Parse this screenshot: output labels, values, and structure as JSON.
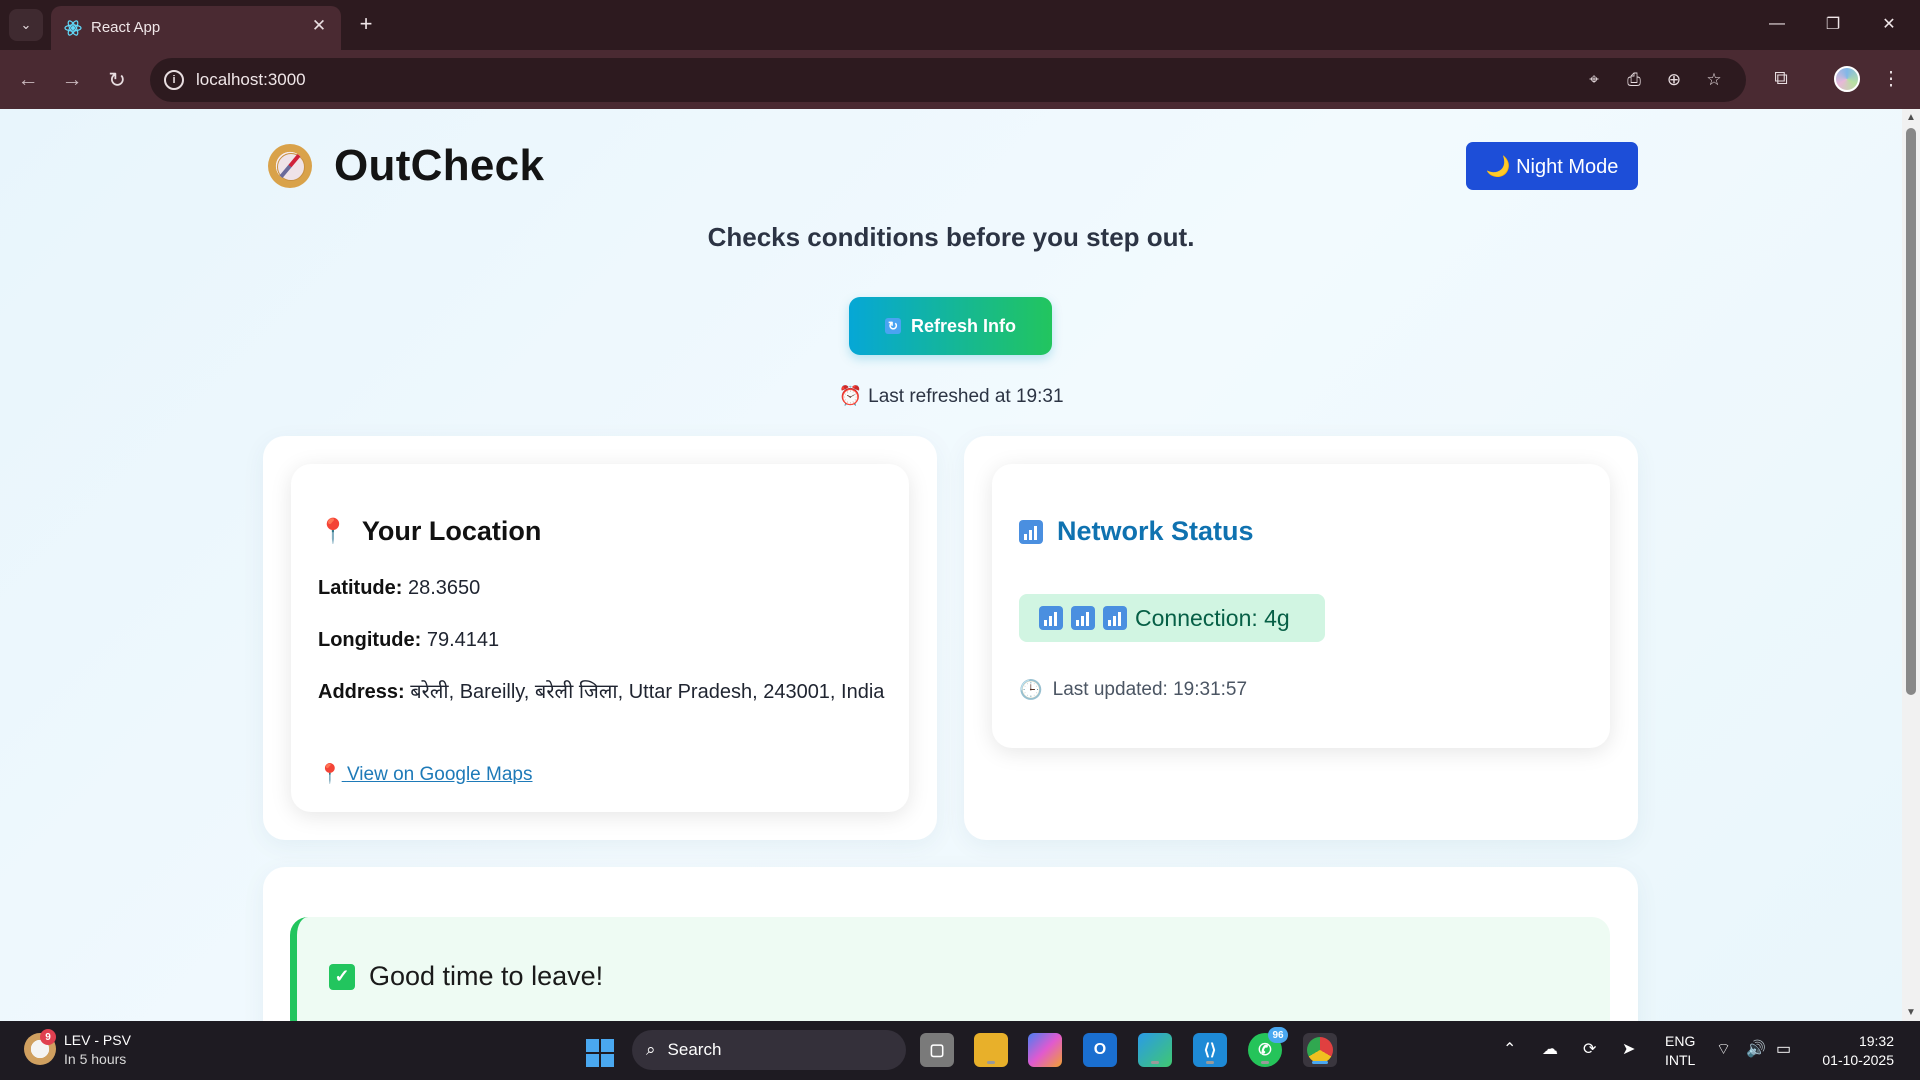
{
  "browser": {
    "tab_title": "React App",
    "url": "localhost:3000"
  },
  "app": {
    "brand_title": "OutCheck",
    "night_mode_label": "🌙 Night Mode",
    "tagline": "Checks conditions before you step out.",
    "refresh_label": "Refresh Info",
    "last_refreshed": "Last refreshed at 19:31"
  },
  "location": {
    "title": "Your Location",
    "latitude_label": "Latitude:",
    "latitude_value": "28.3650",
    "longitude_label": "Longitude:",
    "longitude_value": "79.4141",
    "address_label": "Address:",
    "address_value": "बरेली, Bareilly, बरेली जिला, Uttar Pradesh, 243001, India",
    "maps_link": "View on Google Maps"
  },
  "network": {
    "title": "Network Status",
    "connection": "Connection: 4g",
    "last_updated": "Last updated: 19:31:57"
  },
  "advice": {
    "title": "Good time to leave!"
  },
  "taskbar": {
    "weather_badge": "9",
    "weather_title": "LEV - PSV",
    "weather_sub": "In 5 hours",
    "search_placeholder": "Search",
    "whatsapp_badge": "96",
    "lang_top": "ENG",
    "lang_bottom": "INTL",
    "time": "19:32",
    "date": "01-10-2025"
  },
  "colors": {
    "accent_blue": "#1d4ed8",
    "refresh_gradient_start": "#06a7d6",
    "refresh_gradient_end": "#22c55e",
    "network_title": "#0f72b0",
    "success_green": "#22c55e"
  },
  "icons": [
    "react-favicon",
    "compass-icon",
    "moon-icon",
    "refresh-icon",
    "alarm-clock-icon",
    "pin-icon",
    "signal-bars-icon",
    "clock-icon",
    "check-icon"
  ]
}
